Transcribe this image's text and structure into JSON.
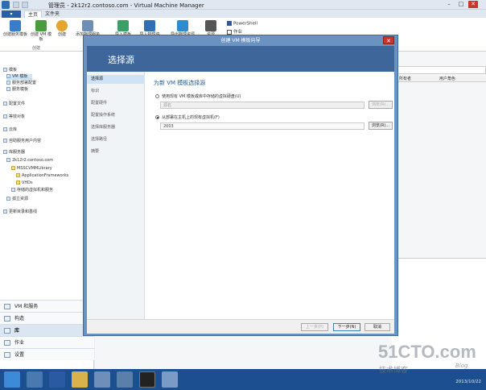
{
  "app": {
    "title": "管理员 - 2k12r2.contoso.com - Virtual Machine Manager",
    "minimize": "–",
    "maximize": "□",
    "close": "✕"
  },
  "ribbon": {
    "tabs": [
      {
        "label": "主页"
      },
      {
        "label": "文件夹"
      }
    ],
    "buttons": [
      {
        "label": "创建服务模板",
        "color": "#3a7cc7"
      },
      {
        "label": "创建 VM 模板",
        "color": "#4a9a3e"
      },
      {
        "label": "创建",
        "color": "#e3a52b"
      },
      {
        "label": "添加物理服务",
        "color": "#6d8fb5"
      },
      {
        "label": "导入模板",
        "color": "#3aa06a"
      },
      {
        "label": "导入物理资源",
        "color": "#2f6fb3"
      },
      {
        "label": "导出物理资源",
        "color": "#2f8bd0"
      },
      {
        "label": "资源",
        "color": "#555"
      }
    ],
    "powershell": "PowerShell",
    "jobs": "作业",
    "group_label": "创建"
  },
  "nav": {
    "items": [
      {
        "label": "模板",
        "indent": 0
      },
      {
        "label": "VM 模板",
        "indent": 1,
        "selected": true
      },
      {
        "label": "服务部署配置",
        "indent": 1
      },
      {
        "label": "服务模板",
        "indent": 1
      },
      {
        "label": "配置文件",
        "indent": 0
      },
      {
        "label": "等效对象",
        "indent": 0
      },
      {
        "label": "云库",
        "indent": 0
      },
      {
        "label": "自助服务用户内容",
        "indent": 0
      },
      {
        "label": "库服务器",
        "indent": 0
      },
      {
        "label": "2k12r2.contoso.com",
        "indent": 1
      },
      {
        "label": "MSSCVMMLibrary",
        "indent": 2
      },
      {
        "label": "ApplicationFrameworks",
        "indent": 3
      },
      {
        "label": "VHDs",
        "indent": 3
      },
      {
        "label": "存储的虚拟机和服务",
        "indent": 2
      },
      {
        "label": "孤立资源",
        "indent": 1
      },
      {
        "label": "更新目录和基线",
        "indent": 0
      }
    ],
    "workspaces": [
      {
        "label": "VM 和服务"
      },
      {
        "label": "构造"
      },
      {
        "label": "库",
        "selected": true
      },
      {
        "label": "作业"
      },
      {
        "label": "设置"
      }
    ]
  },
  "grid": {
    "columns": [
      "所有者",
      "用户角色"
    ]
  },
  "dialog": {
    "title": "创建 VM 模板向导",
    "close": "✕",
    "banner": "选择源",
    "steps": [
      {
        "label": "选择源",
        "selected": true
      },
      {
        "label": "标识"
      },
      {
        "label": "配置硬件"
      },
      {
        "label": "配置操作系统"
      },
      {
        "label": "选择库服务器"
      },
      {
        "label": "选择路径"
      },
      {
        "label": "摘要"
      }
    ],
    "heading": "为新 VM 模板选择源",
    "option1": "使用现有 VM 模板或库中存储的虚拟硬盘(U)",
    "option1_value": "源名",
    "option2": "从部署在主机上的现有虚拟机(F)",
    "option2_value": "2003",
    "browse1": "浏览(R)...",
    "browse2": "浏览(R)...",
    "prev": "上一步(P)",
    "next": "下一步(N)",
    "cancel": "取消"
  },
  "taskbar": {
    "icons": [
      {
        "name": "start",
        "color": "#3d8bd8"
      },
      {
        "name": "server-manager",
        "color": "#4a79b0"
      },
      {
        "name": "powershell",
        "color": "#2a5aa2"
      },
      {
        "name": "explorer",
        "color": "#d8b24a"
      },
      {
        "name": "vmm",
        "color": "#6f8fb8"
      },
      {
        "name": "hyper-v",
        "color": "#5a7fa8"
      },
      {
        "name": "cmd",
        "color": "#222"
      },
      {
        "name": "app",
        "color": "#7a9cc4"
      }
    ],
    "date": "2013/10/22"
  },
  "watermark": {
    "main": "51CTO.com",
    "sub": "技术博客",
    "blog": "Blog"
  }
}
